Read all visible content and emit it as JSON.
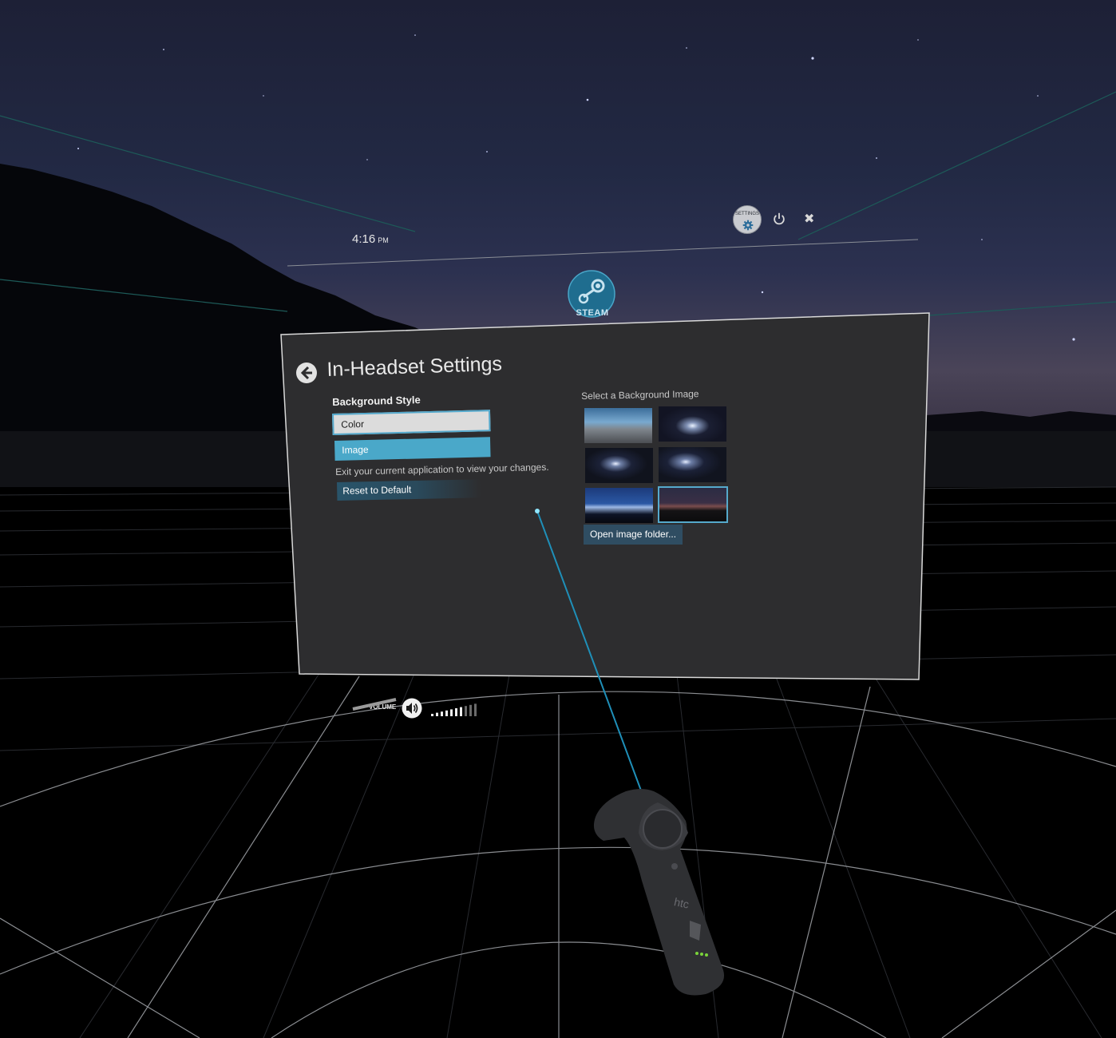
{
  "hud": {
    "time": "4:16",
    "ampm": "PM",
    "settings_label": "SETTINGS",
    "steam_label": "STEAM",
    "close_glyph": "✖"
  },
  "panel": {
    "title": "In-Headset Settings",
    "background_style": {
      "label": "Background Style",
      "options": [
        "Color",
        "Image"
      ],
      "selected": "Image"
    },
    "hint": "Exit your current application to view your changes.",
    "reset_label": "Reset to Default",
    "image_section_label": "Select a Background Image",
    "open_folder_label": "Open image folder..."
  },
  "volume": {
    "label": "VOLUME",
    "level": 0.7
  },
  "controller": {
    "brand": "htc"
  },
  "colors": {
    "accent": "#4aa8c9",
    "panel_bg": "#2d2d2f",
    "laser": "#1f8fb8"
  },
  "icons": [
    "back-arrow-icon",
    "gear-icon",
    "power-icon",
    "close-icon",
    "speaker-icon",
    "steam-logo-icon"
  ]
}
